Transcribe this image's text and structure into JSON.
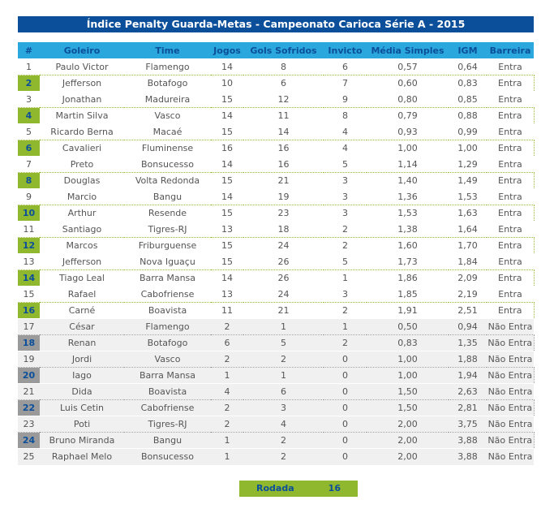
{
  "title": "Índice Penalty Guarda-Metas - Campeonato Carioca Série A - 2015",
  "columns": [
    "#",
    "Goleiro",
    "Time",
    "Jogos",
    "Gols Sofridos",
    "Invicto",
    "Média Simples",
    "IGM",
    "Barreira"
  ],
  "rows": [
    [
      "1",
      "Paulo Victor",
      "Flamengo",
      "14",
      "8",
      "6",
      "0,57",
      "0,64",
      "Entra"
    ],
    [
      "2",
      "Jefferson",
      "Botafogo",
      "10",
      "6",
      "7",
      "0,60",
      "0,83",
      "Entra"
    ],
    [
      "3",
      "Jonathan",
      "Madureira",
      "15",
      "12",
      "9",
      "0,80",
      "0,85",
      "Entra"
    ],
    [
      "4",
      "Martin Silva",
      "Vasco",
      "14",
      "11",
      "8",
      "0,79",
      "0,88",
      "Entra"
    ],
    [
      "5",
      "Ricardo Berna",
      "Macaé",
      "15",
      "14",
      "4",
      "0,93",
      "0,99",
      "Entra"
    ],
    [
      "6",
      "Cavalieri",
      "Fluminense",
      "16",
      "16",
      "4",
      "1,00",
      "1,00",
      "Entra"
    ],
    [
      "7",
      "Preto",
      "Bonsucesso",
      "14",
      "16",
      "5",
      "1,14",
      "1,29",
      "Entra"
    ],
    [
      "8",
      "Douglas",
      "Volta Redonda",
      "15",
      "21",
      "3",
      "1,40",
      "1,49",
      "Entra"
    ],
    [
      "9",
      "Marcio",
      "Bangu",
      "14",
      "19",
      "3",
      "1,36",
      "1,53",
      "Entra"
    ],
    [
      "10",
      "Arthur",
      "Resende",
      "15",
      "23",
      "3",
      "1,53",
      "1,63",
      "Entra"
    ],
    [
      "11",
      "Santiago",
      "Tigres-RJ",
      "13",
      "18",
      "2",
      "1,38",
      "1,64",
      "Entra"
    ],
    [
      "12",
      "Marcos",
      "Friburguense",
      "15",
      "24",
      "2",
      "1,60",
      "1,70",
      "Entra"
    ],
    [
      "13",
      "Jefferson",
      "Nova Iguaçu",
      "15",
      "26",
      "5",
      "1,73",
      "1,84",
      "Entra"
    ],
    [
      "14",
      "Tiago Leal",
      "Barra Mansa",
      "14",
      "26",
      "1",
      "1,86",
      "2,09",
      "Entra"
    ],
    [
      "15",
      "Rafael",
      "Cabofriense",
      "13",
      "24",
      "3",
      "1,85",
      "2,19",
      "Entra"
    ],
    [
      "16",
      "Carné",
      "Boavista",
      "11",
      "21",
      "2",
      "1,91",
      "2,51",
      "Entra"
    ],
    [
      "17",
      "César",
      "Flamengo",
      "2",
      "1",
      "1",
      "0,50",
      "0,94",
      "Não Entra"
    ],
    [
      "18",
      "Renan",
      "Botafogo",
      "6",
      "5",
      "2",
      "0,83",
      "1,35",
      "Não Entra"
    ],
    [
      "19",
      "Jordi",
      "Vasco",
      "2",
      "2",
      "0",
      "1,00",
      "1,88",
      "Não Entra"
    ],
    [
      "20",
      "Iago",
      "Barra Mansa",
      "1",
      "1",
      "0",
      "1,00",
      "1,94",
      "Não Entra"
    ],
    [
      "21",
      "Dida",
      "Boavista",
      "4",
      "6",
      "0",
      "1,50",
      "2,63",
      "Não Entra"
    ],
    [
      "22",
      "Luis Cetin",
      "Cabofriense",
      "2",
      "3",
      "0",
      "1,50",
      "2,81",
      "Não Entra"
    ],
    [
      "23",
      "Poti",
      "Tigres-RJ",
      "2",
      "4",
      "0",
      "2,00",
      "3,75",
      "Não Entra"
    ],
    [
      "24",
      "Bruno Miranda",
      "Bangu",
      "1",
      "2",
      "0",
      "2,00",
      "3,88",
      "Não Entra"
    ],
    [
      "25",
      "Raphael Melo",
      "Bonsucesso",
      "1",
      "2",
      "0",
      "2,00",
      "3,88",
      "Não Entra"
    ]
  ],
  "footer": {
    "label": "Rodada",
    "value": "16"
  },
  "colors": {
    "title_bg": "#0b4f9a",
    "header_bg": "#2aa8de",
    "accent_green": "#8fb82e",
    "accent_gray": "#9a9a9a"
  }
}
